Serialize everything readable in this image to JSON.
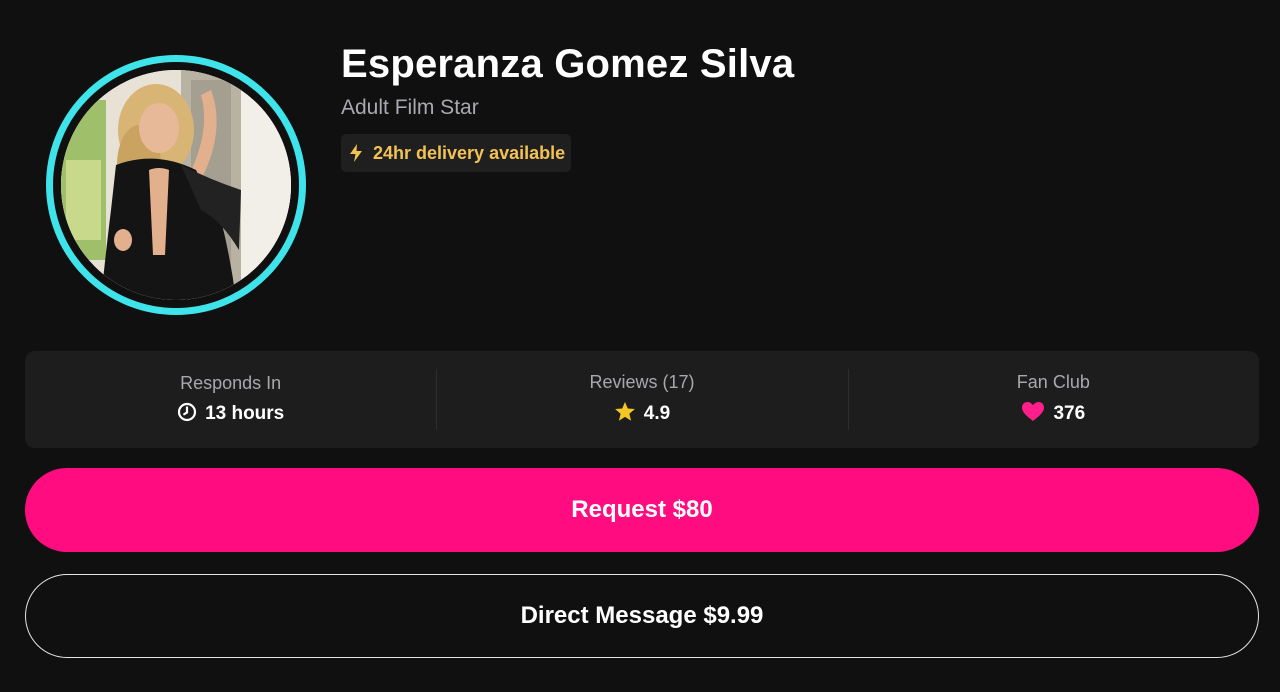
{
  "profile": {
    "name": "Esperanza Gomez Silva",
    "subtitle": "Adult Film Star",
    "avatar_ring_color": "#3fe3ea",
    "delivery_badge": {
      "icon": "lightning-bolt-icon",
      "text": "24hr delivery available",
      "color": "#f3c254"
    }
  },
  "stats": [
    {
      "label": "Responds In",
      "icon": "clock-icon",
      "value": "13 hours"
    },
    {
      "label": "Reviews (17)",
      "icon": "star-icon",
      "value": "4.9",
      "icon_color": "#f6c623"
    },
    {
      "label": "Fan Club",
      "icon": "heart-icon",
      "value": "376",
      "icon_color": "#ff1f8a"
    }
  ],
  "actions": {
    "request_label": "Request $80",
    "request_color": "#ff0c80",
    "direct_message_label": "Direct Message $9.99"
  }
}
